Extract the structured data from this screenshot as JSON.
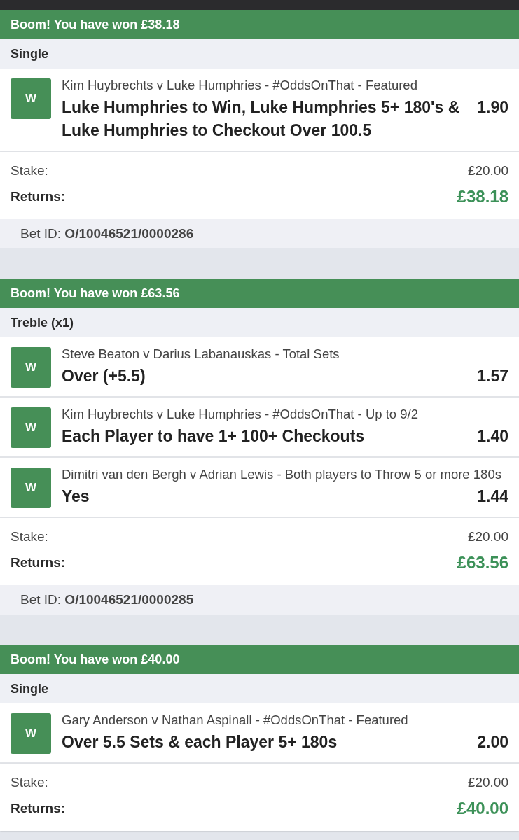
{
  "bets": [
    {
      "banner": "Boom! You have won £38.18",
      "type": "Single",
      "selections": [
        {
          "result": "W",
          "event": "Kim Huybrechts v Luke Humphries - #OddsOnThat - Featured",
          "selection": "Luke Humphries to Win, Luke Humphries 5+ 180's & Luke Humphries to Checkout Over 100.5",
          "odds": "1.90"
        }
      ],
      "stake_label": "Stake:",
      "stake": "£20.00",
      "returns_label": "Returns:",
      "returns": "£38.18",
      "bet_id": "Bet ID: **O/10046521/0000286**"
    },
    {
      "banner": "Boom! You have won £63.56",
      "type": "Treble (x1)",
      "selections": [
        {
          "result": "W",
          "event": "Steve Beaton v Darius Labanauskas - Total Sets",
          "selection": "Over (+5.5)",
          "odds": "1.57"
        },
        {
          "result": "W",
          "event": "Kim Huybrechts v Luke Humphries - #OddsOnThat - Up to 9/2",
          "selection": "Each Player to have 1+ 100+ Checkouts",
          "odds": "1.40"
        },
        {
          "result": "W",
          "event": "Dimitri van den Bergh v Adrian Lewis - Both players to Throw 5 or more 180s",
          "selection": "Yes",
          "odds": "1.44"
        }
      ],
      "stake_label": "Stake:",
      "stake": "£20.00",
      "returns_label": "Returns:",
      "returns": "£63.56",
      "bet_id": "Bet ID: **O/10046521/0000285**"
    },
    {
      "banner": "Boom! You have won £40.00",
      "type": "Single",
      "selections": [
        {
          "result": "W",
          "event": "Gary Anderson v Nathan Aspinall - #OddsOnThat - Featured",
          "selection": "Over 5.5 Sets & each Player 5+ 180s",
          "odds": "2.00"
        }
      ],
      "stake_label": "Stake:",
      "stake": "£20.00",
      "returns_label": "Returns:",
      "returns": "£40.00"
    }
  ]
}
